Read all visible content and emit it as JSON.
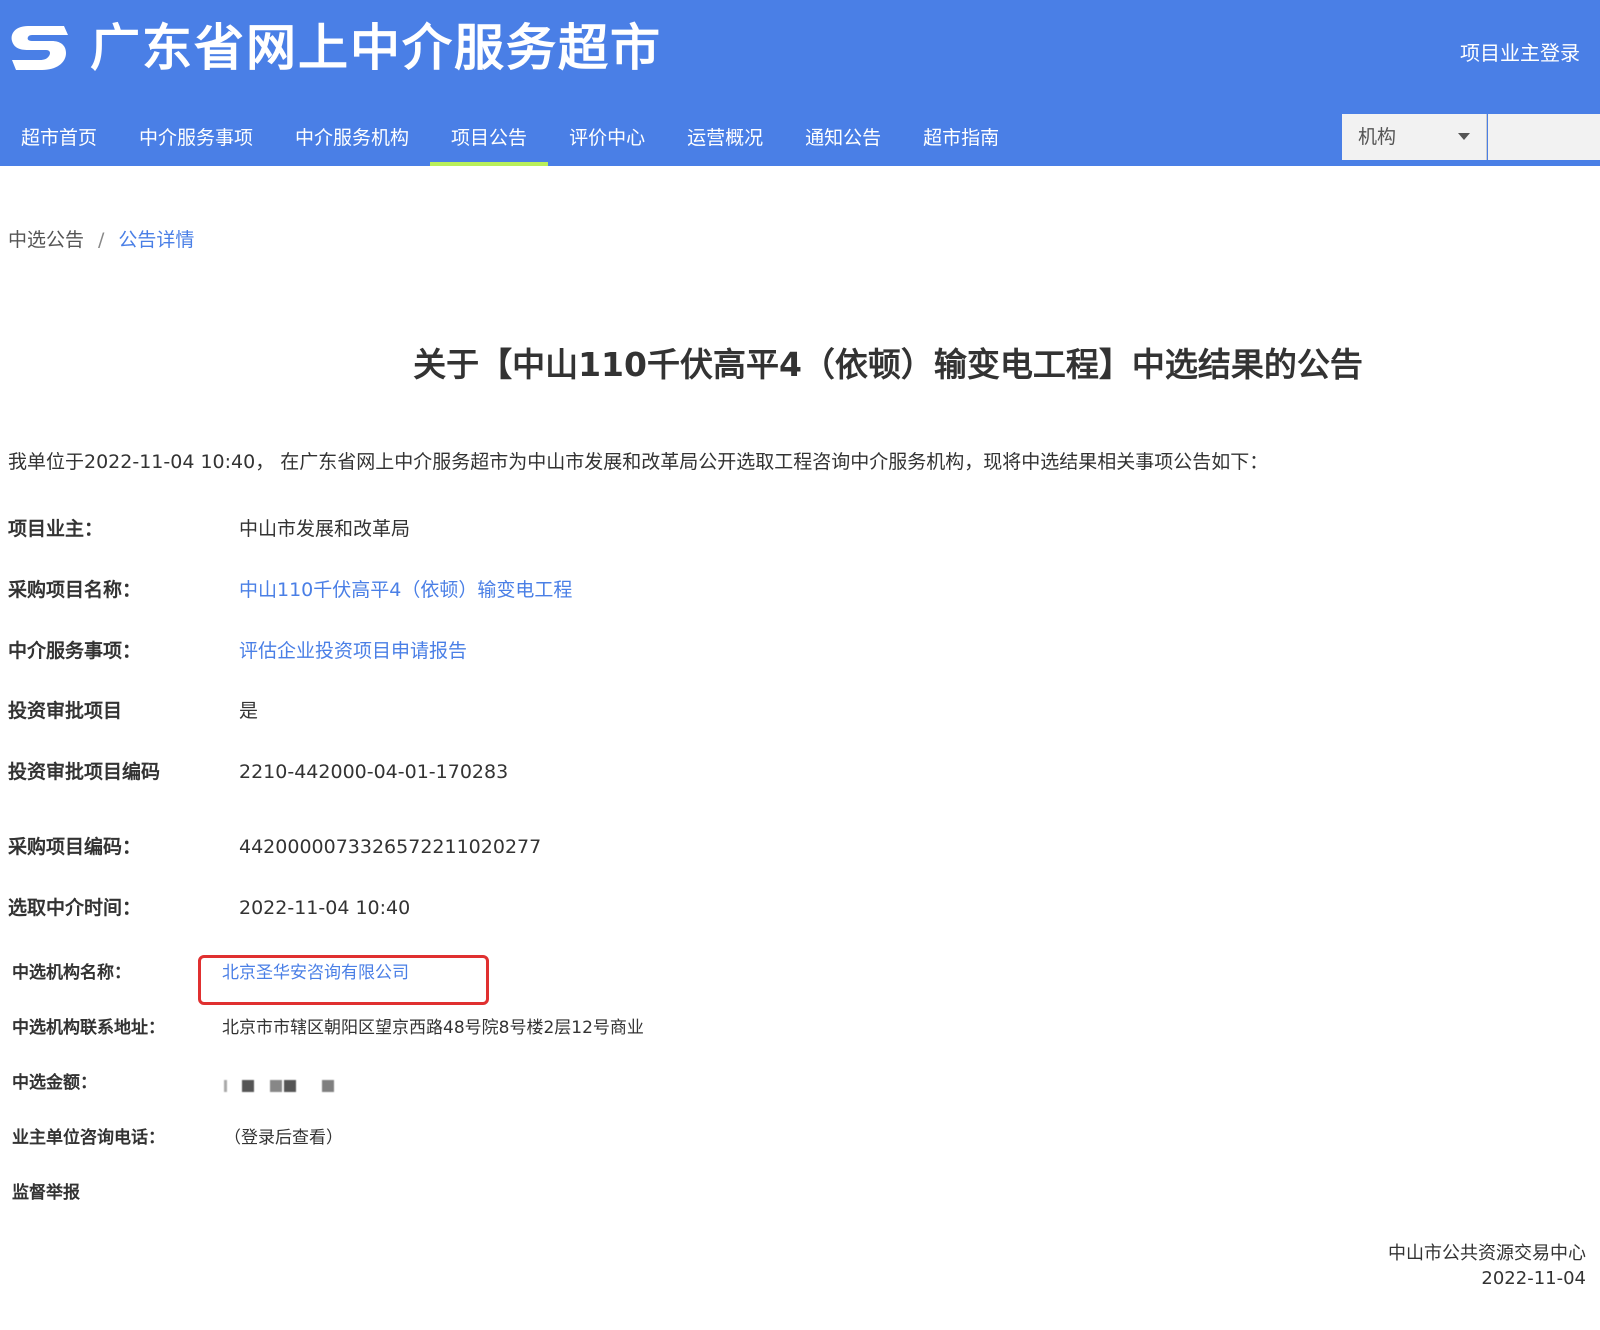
{
  "header": {
    "site_title": "广东省网上中介服务超市",
    "login_label": "项目业主登录",
    "brand_color": "#4a7fe6",
    "active_tab_underline_color": "#b9ef5a"
  },
  "nav": {
    "items": [
      {
        "label": "超市首页"
      },
      {
        "label": "中介服务事项"
      },
      {
        "label": "中介服务机构"
      },
      {
        "label": "项目公告",
        "active": true
      },
      {
        "label": "评价中心"
      },
      {
        "label": "运营概况"
      },
      {
        "label": "通知公告"
      },
      {
        "label": "超市指南"
      }
    ]
  },
  "search": {
    "scope_selected": "机构",
    "query": ""
  },
  "breadcrumb": {
    "parent": "中选公告",
    "separator": "/",
    "current": "公告详情"
  },
  "notice": {
    "title": "关于【中山110千伏高平4（依顿）输变电工程】中选结果的公告",
    "intro": "我单位于2022-11-04 10:40， 在广东省网上中介服务超市为中山市发展和改革局公开选取工程咨询中介服务机构，现将中选结果相关事项公告如下：",
    "fields": {
      "owner": {
        "label": "项目业主：",
        "value": "中山市发展和改革局"
      },
      "project_name": {
        "label": "采购项目名称：",
        "value": "中山110千伏高平4（依顿）输变电工程"
      },
      "service_item": {
        "label": "中介服务事项：",
        "value": "评估企业投资项目申请报告"
      },
      "approval_project": {
        "label": "投资审批项目",
        "value": "是"
      },
      "approval_code": {
        "label": "投资审批项目编码",
        "value": "2210-442000-04-01-170283"
      },
      "purchase_code": {
        "label": "采购项目编码：",
        "value": "4420000073326572211020277"
      },
      "select_time": {
        "label": "选取中介时间：",
        "value": "2022-11-04 10:40"
      },
      "winner_name": {
        "label": "中选机构名称：",
        "value": "北京圣华安咨询有限公司"
      },
      "winner_address": {
        "label": "中选机构联系地址：",
        "value": "北京市市辖区朝阳区望京西路48号院8号楼2层12号商业"
      },
      "amount": {
        "label": "中选金额：",
        "value_obscured": true
      },
      "owner_phone": {
        "label": "业主单位咨询电话：",
        "value": "（登录后查看）"
      },
      "supervision": {
        "label": "监督举报"
      }
    },
    "issuer": "中山市公共资源交易中心",
    "date": "2022-11-04"
  },
  "highlight_color": "#e03030"
}
